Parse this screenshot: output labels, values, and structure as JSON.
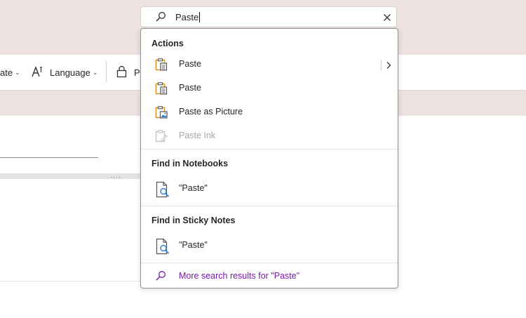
{
  "ribbon": {
    "items": [
      {
        "label": "ate"
      },
      {
        "label": "Language"
      },
      {
        "label": "P"
      }
    ]
  },
  "search": {
    "value": "Paste"
  },
  "dropdown": {
    "sections": [
      {
        "title": "Actions",
        "items": [
          {
            "label": "Paste",
            "icon": "paste-icon",
            "has_submenu": true,
            "disabled": false
          },
          {
            "label": "Paste",
            "icon": "paste-icon",
            "has_submenu": false,
            "disabled": false
          },
          {
            "label": "Paste as Picture",
            "icon": "paste-picture-icon",
            "has_submenu": false,
            "disabled": false
          },
          {
            "label": "Paste Ink",
            "icon": "paste-ink-icon",
            "has_submenu": false,
            "disabled": true
          }
        ]
      },
      {
        "title": "Find in Notebooks",
        "items": [
          {
            "label": "\"Paste\"",
            "icon": "page-search-icon"
          }
        ]
      },
      {
        "title": "Find in Sticky Notes",
        "items": [
          {
            "label": "\"Paste\"",
            "icon": "page-search-icon"
          }
        ]
      }
    ],
    "more_results": "More search results for \"Paste\""
  },
  "colors": {
    "titlebar": "#ede2e0",
    "accent_purple": "#7719aa",
    "paste_orange": "#d58a1c"
  }
}
